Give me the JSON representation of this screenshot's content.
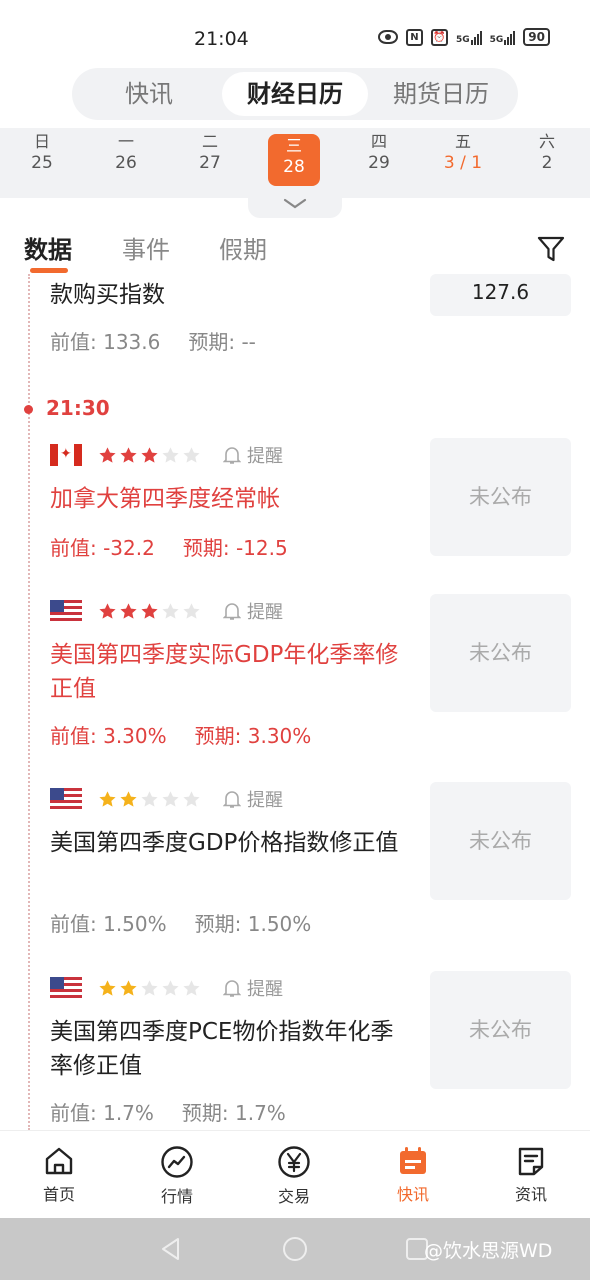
{
  "status_bar": {
    "time": "21:04",
    "nfc": "N",
    "signal1": "5G",
    "signal2": "5G",
    "battery": "90"
  },
  "top_tabs": [
    {
      "label": "快讯",
      "active": false
    },
    {
      "label": "财经日历",
      "active": true
    },
    {
      "label": "期货日历",
      "active": false
    }
  ],
  "week": [
    {
      "name": "日",
      "num": "25"
    },
    {
      "name": "一",
      "num": "26"
    },
    {
      "name": "二",
      "num": "27"
    },
    {
      "name": "三",
      "num": "28",
      "selected": true
    },
    {
      "name": "四",
      "num": "29"
    },
    {
      "name": "五",
      "num": "3 / 1"
    },
    {
      "name": "六",
      "num": "2"
    }
  ],
  "sub_tabs": [
    {
      "label": "数据",
      "active": true
    },
    {
      "label": "事件",
      "active": false
    },
    {
      "label": "假期",
      "active": false
    }
  ],
  "partial_event": {
    "title_tail": "款购买指数",
    "prev": "前值: 133.6",
    "forecast": "预期: --",
    "actual": "127.6"
  },
  "time_group": "21:30",
  "remind_label": "提醒",
  "events": [
    {
      "flag": "canada-flag",
      "stars": 3,
      "title": "加拿大第四季度经常帐",
      "prev": "前值: -32.2",
      "forecast": "预期: -12.5",
      "status": "未公布",
      "highlight": true
    },
    {
      "flag": "us-flag",
      "stars": 3,
      "title": "美国第四季度实际GDP年化季率修正值",
      "prev": "前值: 3.30%",
      "forecast": "预期: 3.30%",
      "status": "未公布",
      "highlight": true
    },
    {
      "flag": "us-flag",
      "stars": 2,
      "title": "美国第四季度GDP价格指数修正值",
      "prev": "前值: 1.50%",
      "forecast": "预期: 1.50%",
      "status": "未公布",
      "highlight": false
    },
    {
      "flag": "us-flag",
      "stars": 2,
      "title": "美国第四季度PCE物价指数年化季率修正值",
      "prev": "前值: 1.7%",
      "forecast": "预期: 1.7%",
      "status": "未公布",
      "highlight": false
    }
  ],
  "bottom_nav": [
    {
      "label": "首页",
      "icon": "home-icon"
    },
    {
      "label": "行情",
      "icon": "market-chart-icon"
    },
    {
      "label": "交易",
      "icon": "yen-trade-icon"
    },
    {
      "label": "快讯",
      "icon": "calendar-icon",
      "active": true
    },
    {
      "label": "资讯",
      "icon": "news-doc-icon"
    }
  ],
  "watermark": "@饮水思源WD",
  "colors": {
    "accent": "#f26a2e",
    "alert_red": "#e0413f",
    "star_red": "#e0413f",
    "star_gold": "#f5b21b",
    "star_empty": "#e2e2e2"
  }
}
